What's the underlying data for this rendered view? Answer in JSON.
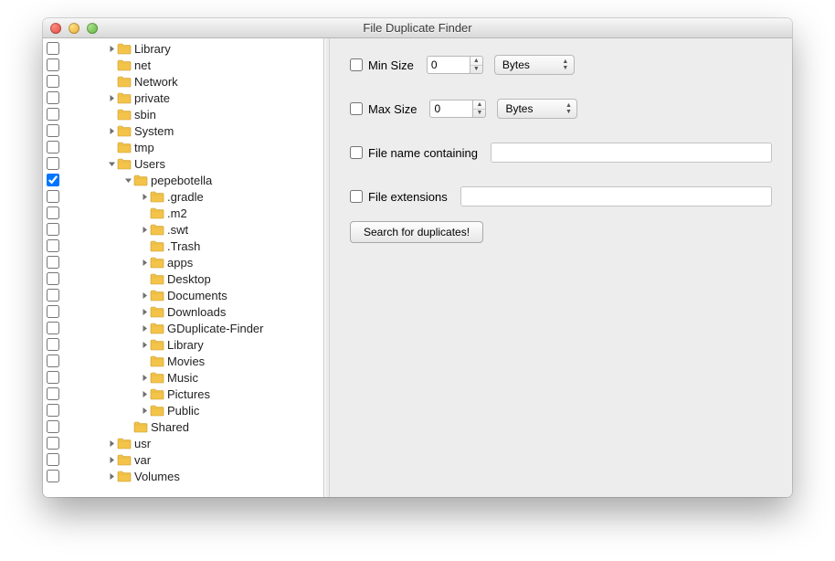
{
  "window": {
    "title": "File Duplicate Finder"
  },
  "tree": [
    {
      "label": "Library",
      "depth": 1,
      "hasChildren": true,
      "expanded": false,
      "checked": false
    },
    {
      "label": "net",
      "depth": 1,
      "hasChildren": false,
      "expanded": false,
      "checked": false
    },
    {
      "label": "Network",
      "depth": 1,
      "hasChildren": false,
      "expanded": false,
      "checked": false
    },
    {
      "label": "private",
      "depth": 1,
      "hasChildren": true,
      "expanded": false,
      "checked": false
    },
    {
      "label": "sbin",
      "depth": 1,
      "hasChildren": false,
      "expanded": false,
      "checked": false
    },
    {
      "label": "System",
      "depth": 1,
      "hasChildren": true,
      "expanded": false,
      "checked": false
    },
    {
      "label": "tmp",
      "depth": 1,
      "hasChildren": false,
      "expanded": false,
      "checked": false
    },
    {
      "label": "Users",
      "depth": 1,
      "hasChildren": true,
      "expanded": true,
      "checked": false
    },
    {
      "label": "pepebotella",
      "depth": 2,
      "hasChildren": true,
      "expanded": true,
      "checked": true
    },
    {
      "label": ".gradle",
      "depth": 3,
      "hasChildren": true,
      "expanded": false,
      "checked": false
    },
    {
      "label": ".m2",
      "depth": 3,
      "hasChildren": false,
      "expanded": false,
      "checked": false
    },
    {
      "label": ".swt",
      "depth": 3,
      "hasChildren": true,
      "expanded": false,
      "checked": false
    },
    {
      "label": ".Trash",
      "depth": 3,
      "hasChildren": false,
      "expanded": false,
      "checked": false
    },
    {
      "label": "apps",
      "depth": 3,
      "hasChildren": true,
      "expanded": false,
      "checked": false
    },
    {
      "label": "Desktop",
      "depth": 3,
      "hasChildren": false,
      "expanded": false,
      "checked": false
    },
    {
      "label": "Documents",
      "depth": 3,
      "hasChildren": true,
      "expanded": false,
      "checked": false
    },
    {
      "label": "Downloads",
      "depth": 3,
      "hasChildren": true,
      "expanded": false,
      "checked": false
    },
    {
      "label": "GDuplicate-Finder",
      "depth": 3,
      "hasChildren": true,
      "expanded": false,
      "checked": false
    },
    {
      "label": "Library",
      "depth": 3,
      "hasChildren": true,
      "expanded": false,
      "checked": false
    },
    {
      "label": "Movies",
      "depth": 3,
      "hasChildren": false,
      "expanded": false,
      "checked": false
    },
    {
      "label": "Music",
      "depth": 3,
      "hasChildren": true,
      "expanded": false,
      "checked": false
    },
    {
      "label": "Pictures",
      "depth": 3,
      "hasChildren": true,
      "expanded": false,
      "checked": false
    },
    {
      "label": "Public",
      "depth": 3,
      "hasChildren": true,
      "expanded": false,
      "checked": false
    },
    {
      "label": "Shared",
      "depth": 2,
      "hasChildren": false,
      "expanded": false,
      "checked": false
    },
    {
      "label": "usr",
      "depth": 1,
      "hasChildren": true,
      "expanded": false,
      "checked": false
    },
    {
      "label": "var",
      "depth": 1,
      "hasChildren": true,
      "expanded": false,
      "checked": false
    },
    {
      "label": "Volumes",
      "depth": 1,
      "hasChildren": true,
      "expanded": false,
      "checked": false
    }
  ],
  "form": {
    "minSize": {
      "label": "Min Size",
      "value": "0",
      "unit": "Bytes"
    },
    "maxSize": {
      "label": "Max Size",
      "value": "0",
      "unit": "Bytes"
    },
    "nameContains": {
      "label": "File name containing",
      "value": ""
    },
    "extensions": {
      "label": "File extensions",
      "value": ""
    },
    "searchButton": "Search for duplicates!"
  }
}
